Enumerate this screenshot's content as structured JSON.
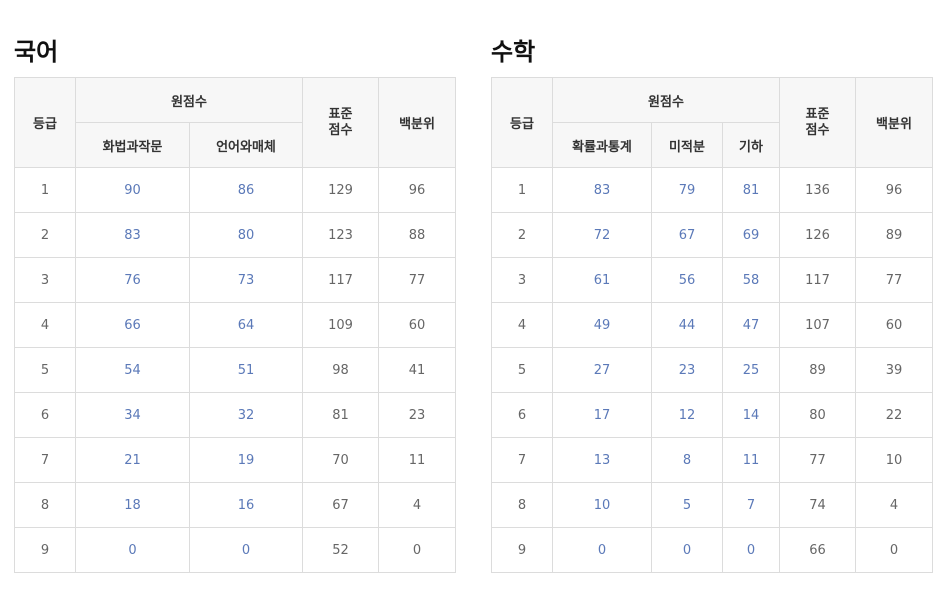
{
  "korean": {
    "title": "국어",
    "header": {
      "grade": "등급",
      "raw": "원점수",
      "sub1": "화법과작문",
      "sub2": "언어와매체",
      "std_line1": "표준",
      "std_line2": "점수",
      "pct": "백분위"
    },
    "rows": [
      {
        "grade": "1",
        "a": "90",
        "b": "86",
        "std": "129",
        "pct": "96"
      },
      {
        "grade": "2",
        "a": "83",
        "b": "80",
        "std": "123",
        "pct": "88"
      },
      {
        "grade": "3",
        "a": "76",
        "b": "73",
        "std": "117",
        "pct": "77"
      },
      {
        "grade": "4",
        "a": "66",
        "b": "64",
        "std": "109",
        "pct": "60"
      },
      {
        "grade": "5",
        "a": "54",
        "b": "51",
        "std": "98",
        "pct": "41"
      },
      {
        "grade": "6",
        "a": "34",
        "b": "32",
        "std": "81",
        "pct": "23"
      },
      {
        "grade": "7",
        "a": "21",
        "b": "19",
        "std": "70",
        "pct": "11"
      },
      {
        "grade": "8",
        "a": "18",
        "b": "16",
        "std": "67",
        "pct": "4"
      },
      {
        "grade": "9",
        "a": "0",
        "b": "0",
        "std": "52",
        "pct": "0"
      }
    ]
  },
  "math": {
    "title": "수학",
    "header": {
      "grade": "등급",
      "raw": "원점수",
      "sub1": "확률과통계",
      "sub2": "미적분",
      "sub3": "기하",
      "std_line1": "표준",
      "std_line2": "점수",
      "pct": "백분위"
    },
    "rows": [
      {
        "grade": "1",
        "a": "83",
        "b": "79",
        "c": "81",
        "std": "136",
        "pct": "96"
      },
      {
        "grade": "2",
        "a": "72",
        "b": "67",
        "c": "69",
        "std": "126",
        "pct": "89"
      },
      {
        "grade": "3",
        "a": "61",
        "b": "56",
        "c": "58",
        "std": "117",
        "pct": "77"
      },
      {
        "grade": "4",
        "a": "49",
        "b": "44",
        "c": "47",
        "std": "107",
        "pct": "60"
      },
      {
        "grade": "5",
        "a": "27",
        "b": "23",
        "c": "25",
        "std": "89",
        "pct": "39"
      },
      {
        "grade": "6",
        "a": "17",
        "b": "12",
        "c": "14",
        "std": "80",
        "pct": "22"
      },
      {
        "grade": "7",
        "a": "13",
        "b": "8",
        "c": "11",
        "std": "77",
        "pct": "10"
      },
      {
        "grade": "8",
        "a": "10",
        "b": "5",
        "c": "7",
        "std": "74",
        "pct": "4"
      },
      {
        "grade": "9",
        "a": "0",
        "b": "0",
        "c": "0",
        "std": "66",
        "pct": "0"
      }
    ]
  }
}
